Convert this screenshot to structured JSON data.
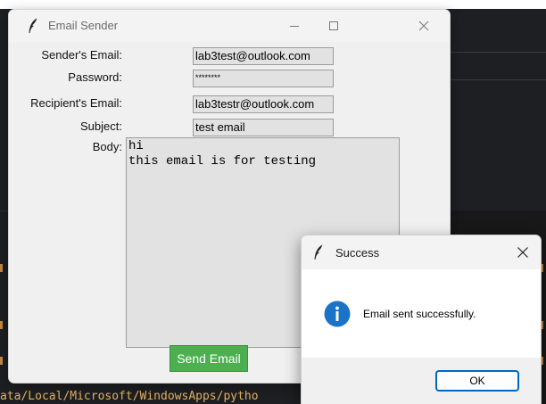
{
  "main_window": {
    "title": "Email Sender",
    "controls": {
      "minimize_icon": "minimize-icon",
      "maximize_icon": "maximize-icon",
      "close_icon": "close-icon"
    },
    "form": {
      "sender_label": "Sender's Email:",
      "sender_value": "lab3test@outlook.com",
      "password_label": "Password:",
      "password_value": "********",
      "recipient_label": "Recipient's Email:",
      "recipient_value": "lab3testr@outlook.com",
      "subject_label": "Subject:",
      "subject_value": "test email",
      "body_label": "Body:",
      "body_value": "hi\nthis email is for testing"
    },
    "send_button_label": "Send Email",
    "send_button_color": "#4caf50"
  },
  "dialog": {
    "title": "Success",
    "message": "Email sent successfully.",
    "ok_label": "OK",
    "icon": "info-icon",
    "accent_color": "#0067c0"
  },
  "terminal": {
    "path_text": "ata/Local/Microsoft/WindowsApps/pytho"
  }
}
